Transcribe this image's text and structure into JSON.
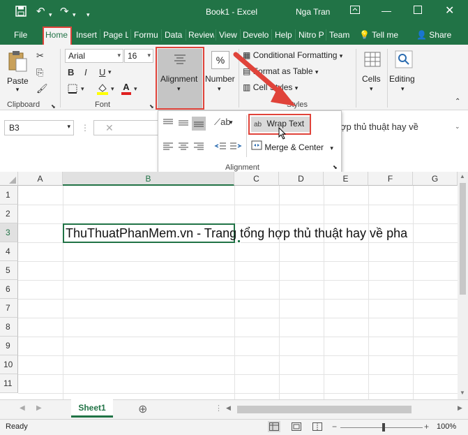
{
  "titlebar": {
    "title": "Book1  -  Excel",
    "user": "Nga Tran"
  },
  "tabs": [
    "File",
    "Home",
    "Insert",
    "Page L",
    "Formu",
    "Data",
    "Review",
    "View",
    "Develo",
    "Help",
    "Nitro P",
    "Team"
  ],
  "tell_me": "Tell me",
  "share": "Share",
  "ribbon": {
    "clipboard": {
      "paste": "Paste",
      "label": "Clipboard"
    },
    "font": {
      "name": "Arial",
      "size": "16",
      "bold": "B",
      "italic": "I",
      "underline": "U",
      "font_color_letter": "A",
      "label": "Font"
    },
    "alignment": {
      "label": "Alignment"
    },
    "number": {
      "label": "Number",
      "icon": "%"
    },
    "styles": {
      "conditional": "Conditional Formatting",
      "format_table": "Format as Table",
      "cell_styles": "Cell Styles",
      "label": "Styles"
    },
    "cells": {
      "label": "Cells"
    },
    "editing": {
      "label": "Editing"
    }
  },
  "formula": {
    "namebox": "B3",
    "content": "ợp thủ thuật hay về"
  },
  "popup": {
    "wrap_text": "Wrap Text",
    "merge_center": "Merge & Center",
    "label": "Alignment",
    "wrap_icon": "ab"
  },
  "grid": {
    "columns": [
      "A",
      "B",
      "C",
      "D",
      "E",
      "F",
      "G"
    ],
    "rows": [
      "1",
      "2",
      "3",
      "4",
      "5",
      "6",
      "7",
      "8",
      "9",
      "10",
      "11"
    ],
    "selected_cell": "B3",
    "cell_b3": "ThuThuatPhanMem.vn - Trang tổng hợp thủ thuật hay về pha"
  },
  "sheets": {
    "active": "Sheet1"
  },
  "status": {
    "ready": "Ready",
    "zoom": "100%"
  },
  "colors": {
    "excel_green": "#217346",
    "highlight": "#e0433a"
  }
}
